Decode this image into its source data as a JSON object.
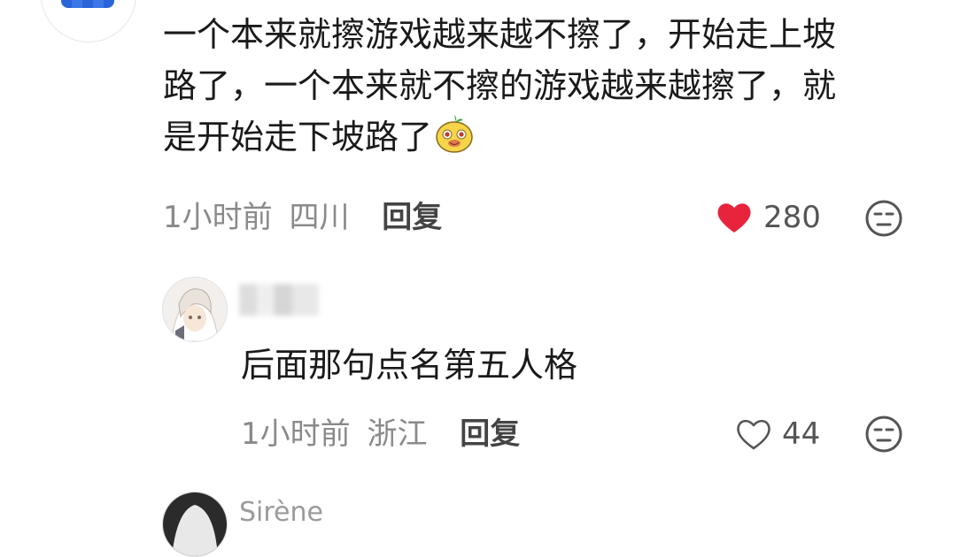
{
  "comment": {
    "text_line1": "一个本来就擦游戏越来越不擦了，开始走上坡",
    "text_line2": "路了，一个本来就不擦的游戏越来越擦了，就",
    "text_line3": "是开始走下坡路了",
    "emoji": "smirk-sticker",
    "time": "1小时前",
    "location": "四川",
    "reply_label": "回复",
    "likes": "280",
    "liked": true,
    "like_color": "#e8243c"
  },
  "reply": {
    "username": "",
    "text": "后面那句点名第五人格",
    "time": "1小时前",
    "location": "浙江",
    "reply_label": "回复",
    "likes": "44",
    "liked": false
  },
  "next_comment": {
    "username": "Sirène"
  }
}
